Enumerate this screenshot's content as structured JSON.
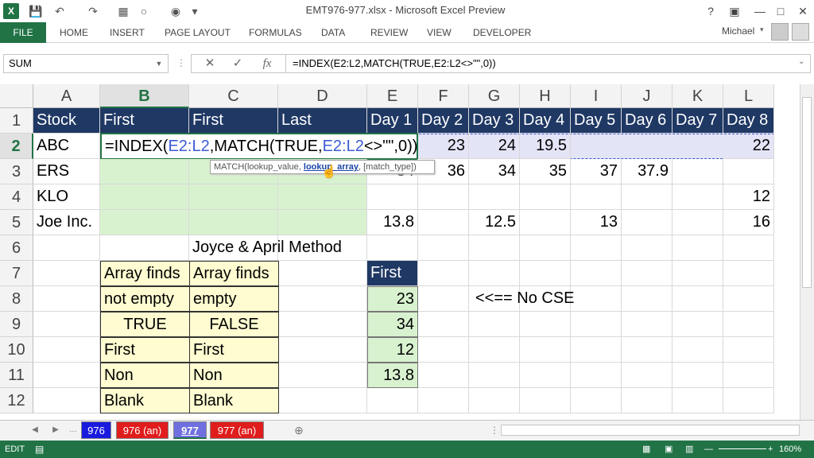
{
  "window": {
    "title": "EMT976-977.xlsx - Microsoft Excel Preview"
  },
  "ribbon": {
    "tabs": [
      "FILE",
      "HOME",
      "INSERT",
      "PAGE LAYOUT",
      "FORMULAS",
      "DATA",
      "REVIEW",
      "VIEW",
      "DEVELOPER"
    ],
    "user": "Michael"
  },
  "formula_bar": {
    "name_box": "SUM",
    "formula": "=INDEX(E2:L2,MATCH(TRUE,E2:L2<>\"\",0))"
  },
  "columns": [
    "A",
    "B",
    "C",
    "D",
    "E",
    "F",
    "G",
    "H",
    "I",
    "J",
    "K",
    "L"
  ],
  "rows": [
    "1",
    "2",
    "3",
    "4",
    "5",
    "6",
    "7",
    "8",
    "9",
    "10",
    "11",
    "12"
  ],
  "grid": {
    "header": [
      "Stock",
      "First",
      "First",
      "Last",
      "Day 1",
      "Day 2",
      "Day 3",
      "Day 4",
      "Day 5",
      "Day 6",
      "Day 7",
      "Day 8"
    ],
    "row2": {
      "a": "ABC",
      "edit_prefix": "=INDEX(",
      "ref1": "E2:L2",
      "mid": ",MATCH(",
      "mid2": "TRUE,",
      "ref2": "E2:L2",
      "suffix": "<>\"\",0))",
      "f": "23",
      "g": "24",
      "h": "19.5",
      "l": "22"
    },
    "row3": {
      "a": "ERS",
      "e": "34",
      "f": "36",
      "g": "34",
      "h": "35",
      "i": "37",
      "j": "37.9"
    },
    "row4": {
      "a": "KLO",
      "l": "12"
    },
    "row5": {
      "a": "Joe Inc.",
      "e": "13.8",
      "g": "12.5",
      "i": "13",
      "l": "16"
    },
    "row6": {
      "c": "Joyce & April Method"
    },
    "box_b": [
      "Array finds",
      "not empty",
      "TRUE",
      "First",
      "Non",
      "Blank"
    ],
    "box_c": [
      "Array finds",
      "empty",
      "FALSE",
      "First",
      "Non",
      "Blank"
    ],
    "first_header": "First",
    "first_values": [
      "23",
      "34",
      "12",
      "13.8"
    ],
    "note": "<<== No CSE"
  },
  "tooltip": {
    "pre": "MATCH(lookup_value, ",
    "active": "lookup_array",
    "post": ", [match_type])"
  },
  "sheets": [
    {
      "label": "976",
      "color": "#1a1adf"
    },
    {
      "label": "976 (an)",
      "color": "#e01c1c"
    },
    {
      "label": "977",
      "color": "#6f6fe0"
    },
    {
      "label": "977 (an)",
      "color": "#e01c1c"
    }
  ],
  "status": {
    "mode": "EDIT",
    "zoom": "160%"
  }
}
